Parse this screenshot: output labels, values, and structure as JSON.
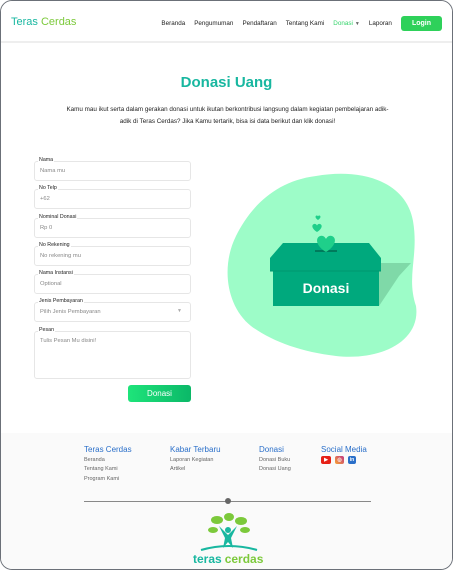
{
  "header": {
    "logo_part1": "Teras",
    "logo_part2": "Cerdas",
    "nav": [
      "Beranda",
      "Pengumuman",
      "Pendaftaran",
      "Tentang Kami",
      "Donasi",
      "Laporan"
    ],
    "login": "Login"
  },
  "main": {
    "title": "Donasi Uang",
    "description": "Kamu mau ikut serta dalam gerakan donasi untuk ikutan berkontribusi langsung dalam kegiatan pembelajaran adik-adik di Teras Cerdas? Jika Kamu tertarik, bisa isi data berikut dan klik donasi!"
  },
  "form": {
    "fields": [
      {
        "label": "Nama",
        "placeholder": "Nama mu"
      },
      {
        "label": "No Telp",
        "placeholder": "+62"
      },
      {
        "label": "Nominal Donasi",
        "placeholder": "Rp 0"
      },
      {
        "label": "No Rekening",
        "placeholder": "No rekening mu"
      },
      {
        "label": "Nama Instansi",
        "placeholder": "Optional"
      },
      {
        "label": "Jenis Pembayaran",
        "placeholder": "Pilih Jenis Pembayaran"
      },
      {
        "label": "Pesan",
        "placeholder": "Tulis Pesan Mu disini!"
      }
    ],
    "submit": "Donasi"
  },
  "illustration": {
    "box_label": "Donasi"
  },
  "footer": {
    "columns": [
      {
        "title": "Teras Cerdas",
        "links": [
          "Beranda",
          "Tentang Kami",
          "Program Kami"
        ]
      },
      {
        "title": "Kabar Terbaru",
        "links": [
          "Laporan Kegiatan",
          "Artikel"
        ]
      },
      {
        "title": "Donasi",
        "links": [
          "Donasi Buku",
          "Donasi Uang"
        ]
      },
      {
        "title": "Social Media",
        "icons": [
          "youtube-icon",
          "instagram-icon",
          "linkedin-icon"
        ]
      }
    ],
    "logo_part1": "teras",
    "logo_part2": "cerdas"
  },
  "colors": {
    "primary": "#18b7a0",
    "accent": "#2ed15a",
    "blob": "#9dfcc8",
    "box": "#00a97d"
  }
}
